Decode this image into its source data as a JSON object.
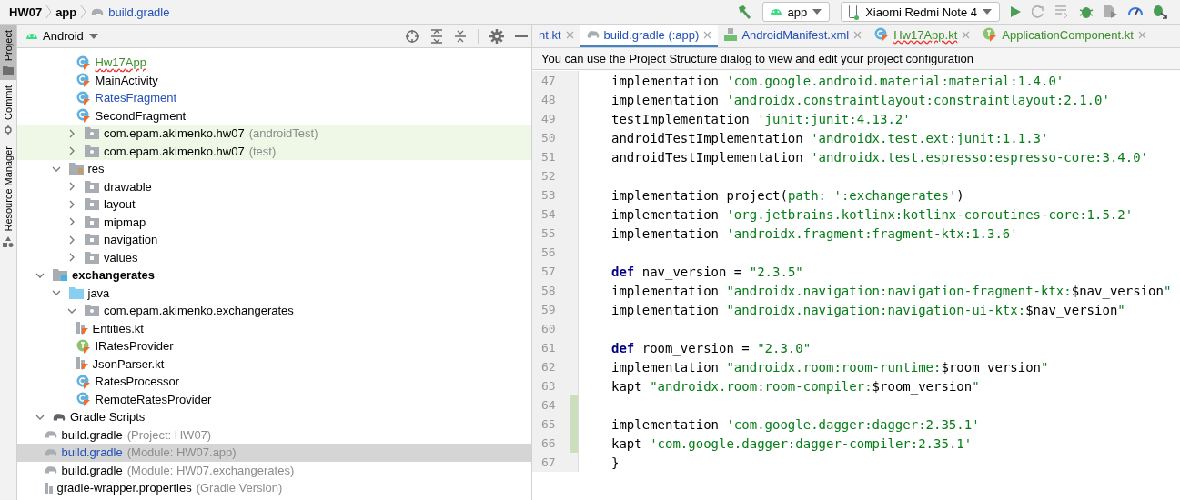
{
  "breadcrumb": [
    {
      "label": "HW07",
      "kind": "project"
    },
    {
      "label": "app",
      "kind": "module"
    },
    {
      "label": "build.gradle",
      "kind": "gradle"
    }
  ],
  "run_config": {
    "label": "app"
  },
  "device": {
    "label": "Xiaomi Redmi Note 4"
  },
  "tool_tabs": [
    {
      "label": "Project",
      "selected": true
    },
    {
      "label": "Commit",
      "selected": false
    },
    {
      "label": "Resource Manager",
      "selected": false
    }
  ],
  "project_view": {
    "mode": "Android"
  },
  "tree": [
    {
      "children": [
        {
          "children": [
            {
              "children": [
                {
                  "label": "Hw17App",
                  "kind": "class",
                  "added": true,
                  "modified": false,
                  "error": true,
                  "selected": false
                },
                {
                  "label": "MainActivity",
                  "kind": "class",
                  "added": false,
                  "modified": false,
                  "error": false,
                  "selected": false
                },
                {
                  "label": "RatesFragment",
                  "kind": "class",
                  "added": false,
                  "modified": true,
                  "error": false,
                  "selected": false
                },
                {
                  "label": "SecondFragment",
                  "kind": "class",
                  "added": false,
                  "modified": false,
                  "error": false,
                  "selected": false
                }
              ]
            },
            {
              "label": "com.epam.akimenko.hw07",
              "note": "(androidTest)",
              "kind": "package",
              "added": false,
              "modified": false,
              "error": false,
              "selected": false,
              "expanded": false,
              "test": true
            },
            {
              "label": "com.epam.akimenko.hw07",
              "note": "(test)",
              "kind": "package",
              "added": false,
              "modified": false,
              "error": false,
              "selected": false,
              "expanded": false,
              "test": true
            }
          ]
        },
        {
          "label": "res",
          "kind": "res-folder",
          "added": false,
          "modified": false,
          "error": false,
          "selected": false,
          "expanded": true,
          "children": [
            {
              "label": "drawable",
              "kind": "folder",
              "added": false,
              "modified": false,
              "error": false,
              "selected": false,
              "expanded": false
            },
            {
              "label": "layout",
              "kind": "folder",
              "added": false,
              "modified": false,
              "error": false,
              "selected": false,
              "expanded": false
            },
            {
              "label": "mipmap",
              "kind": "folder",
              "added": false,
              "modified": false,
              "error": false,
              "selected": false,
              "expanded": false
            },
            {
              "label": "navigation",
              "kind": "folder",
              "added": false,
              "modified": false,
              "error": false,
              "selected": false,
              "expanded": false
            },
            {
              "label": "values",
              "kind": "folder",
              "added": false,
              "modified": false,
              "error": false,
              "selected": false,
              "expanded": false
            }
          ]
        }
      ]
    },
    {
      "label": "exchangerates",
      "kind": "module",
      "added": false,
      "modified": false,
      "error": false,
      "selected": false,
      "expanded": true,
      "children": [
        {
          "label": "java",
          "kind": "java-folder",
          "added": false,
          "modified": false,
          "error": false,
          "selected": false,
          "expanded": true,
          "children": [
            {
              "label": "com.epam.akimenko.exchangerates",
              "kind": "package",
              "added": false,
              "modified": false,
              "error": false,
              "selected": false,
              "expanded": true,
              "children": [
                {
                  "label": "Entities.kt",
                  "kind": "kotlin-file",
                  "added": false,
                  "modified": false,
                  "error": false,
                  "selected": false
                },
                {
                  "label": "IRatesProvider",
                  "kind": "interface",
                  "added": false,
                  "modified": false,
                  "error": false,
                  "selected": false
                },
                {
                  "label": "JsonParser.kt",
                  "kind": "kotlin-file",
                  "added": false,
                  "modified": false,
                  "error": false,
                  "selected": false
                },
                {
                  "label": "RatesProcessor",
                  "kind": "class",
                  "added": false,
                  "modified": false,
                  "error": false,
                  "selected": false
                },
                {
                  "label": "RemoteRatesProvider",
                  "kind": "class",
                  "added": false,
                  "modified": false,
                  "error": false,
                  "selected": false
                }
              ]
            }
          ]
        }
      ]
    },
    {
      "label": "Gradle Scripts",
      "kind": "gradle-scripts",
      "added": false,
      "modified": false,
      "error": false,
      "selected": false,
      "expanded": true,
      "children": [
        {
          "label": "build.gradle",
          "note": "(Project: HW07)",
          "kind": "gradle",
          "added": false,
          "modified": false,
          "error": false,
          "selected": false
        },
        {
          "label": "build.gradle",
          "note": "(Module: HW07.app)",
          "kind": "gradle",
          "added": false,
          "modified": true,
          "error": false,
          "selected": true
        },
        {
          "label": "build.gradle",
          "note": "(Module: HW07.exchangerates)",
          "kind": "gradle",
          "added": false,
          "modified": false,
          "error": false,
          "selected": false
        },
        {
          "label": "gradle-wrapper.properties",
          "note": "(Gradle Version)",
          "kind": "properties",
          "added": false,
          "modified": false,
          "error": false,
          "selected": false
        }
      ]
    }
  ],
  "editor_tabs": [
    {
      "label": "nt.kt",
      "kind": "partial",
      "added": false,
      "modified": true,
      "error": false,
      "selected": false
    },
    {
      "label": "build.gradle (:app)",
      "kind": "gradle",
      "added": false,
      "modified": true,
      "error": false,
      "selected": true
    },
    {
      "label": "AndroidManifest.xml",
      "kind": "manifest",
      "added": false,
      "modified": true,
      "error": false,
      "selected": false
    },
    {
      "label": "Hw17App.kt",
      "kind": "class",
      "added": true,
      "modified": false,
      "error": true,
      "selected": false
    },
    {
      "label": "ApplicationComponent.kt",
      "kind": "interface",
      "added": true,
      "modified": false,
      "error": false,
      "selected": false
    }
  ],
  "banner": "You can use the Project Structure dialog to view and edit your project configuration",
  "code": {
    "lines": [
      {
        "number": "47",
        "changed": false,
        "tokens": [
          {
            "kind": "plain",
            "t": "implementation "
          },
          {
            "kind": "string",
            "t": "'com.google.android.material:material:1.4.0'"
          }
        ]
      },
      {
        "number": "48",
        "changed": false,
        "tokens": [
          {
            "kind": "plain",
            "t": "implementation "
          },
          {
            "kind": "string",
            "t": "'androidx.constraintlayout:constraintlayout:2.1.0'"
          }
        ]
      },
      {
        "number": "49",
        "changed": false,
        "tokens": [
          {
            "kind": "plain",
            "t": "testImplementation "
          },
          {
            "kind": "string",
            "t": "'junit:junit:4.13.2'"
          }
        ]
      },
      {
        "number": "50",
        "changed": false,
        "tokens": [
          {
            "kind": "plain",
            "t": "androidTestImplementation "
          },
          {
            "kind": "string",
            "t": "'androidx.test.ext:junit:1.1.3'"
          }
        ]
      },
      {
        "number": "51",
        "changed": false,
        "tokens": [
          {
            "kind": "plain",
            "t": "androidTestImplementation "
          },
          {
            "kind": "string",
            "t": "'androidx.test.espresso:espresso-core:3.4.0'"
          }
        ]
      },
      {
        "number": "52",
        "changed": false
      },
      {
        "number": "53",
        "changed": false,
        "tokens": [
          {
            "kind": "plain",
            "t": "implementation project("
          },
          {
            "kind": "string",
            "t": "path: ':exchangerates'"
          },
          {
            "kind": "plain",
            "t": ")"
          }
        ]
      },
      {
        "number": "54",
        "changed": false,
        "tokens": [
          {
            "kind": "plain",
            "t": "implementation "
          },
          {
            "kind": "string",
            "t": "'org.jetbrains.kotlinx:kotlinx-coroutines-core:1.5.2'"
          }
        ]
      },
      {
        "number": "55",
        "changed": false,
        "tokens": [
          {
            "kind": "plain",
            "t": "implementation "
          },
          {
            "kind": "string",
            "t": "'androidx.fragment:fragment-ktx:1.3.6'"
          }
        ]
      },
      {
        "number": "56",
        "changed": false
      },
      {
        "number": "57",
        "changed": false,
        "tokens": [
          {
            "kind": "keyword",
            "t": "def"
          },
          {
            "kind": "plain",
            "t": " nav_version = "
          },
          {
            "kind": "string",
            "t": "\"2.3.5\""
          }
        ]
      },
      {
        "number": "58",
        "changed": false,
        "tokens": [
          {
            "kind": "plain",
            "t": "implementation "
          },
          {
            "kind": "string",
            "t": "\"androidx.navigation:navigation-fragment-ktx:"
          },
          {
            "kind": "plain",
            "t": "$nav_version"
          },
          {
            "kind": "string",
            "t": "\""
          }
        ]
      },
      {
        "number": "59",
        "changed": false,
        "tokens": [
          {
            "kind": "plain",
            "t": "implementation "
          },
          {
            "kind": "string",
            "t": "\"androidx.navigation:navigation-ui-ktx:"
          },
          {
            "kind": "plain",
            "t": "$nav_version"
          },
          {
            "kind": "string",
            "t": "\""
          }
        ]
      },
      {
        "number": "60",
        "changed": false
      },
      {
        "number": "61",
        "changed": false,
        "tokens": [
          {
            "kind": "keyword",
            "t": "def"
          },
          {
            "kind": "plain",
            "t": " room_version = "
          },
          {
            "kind": "string",
            "t": "\"2.3.0\""
          }
        ]
      },
      {
        "number": "62",
        "changed": false,
        "tokens": [
          {
            "kind": "plain",
            "t": "implementation "
          },
          {
            "kind": "string",
            "t": "\"androidx.room:room-runtime:"
          },
          {
            "kind": "plain",
            "t": "$room_version"
          },
          {
            "kind": "string",
            "t": "\""
          }
        ]
      },
      {
        "number": "63",
        "changed": false,
        "tokens": [
          {
            "kind": "plain",
            "t": "kapt "
          },
          {
            "kind": "string",
            "t": "\"androidx.room:room-compiler:"
          },
          {
            "kind": "plain",
            "t": "$room_version"
          },
          {
            "kind": "string",
            "t": "\""
          }
        ]
      },
      {
        "number": "64",
        "changed": true
      },
      {
        "number": "65",
        "changed": true,
        "tokens": [
          {
            "kind": "plain",
            "t": "implementation "
          },
          {
            "kind": "string",
            "t": "'com.google.dagger:dagger:2.35.1'"
          }
        ]
      },
      {
        "number": "66",
        "changed": true,
        "tokens": [
          {
            "kind": "plain",
            "t": "kapt "
          },
          {
            "kind": "string",
            "t": "'com.google.dagger:dagger-compiler:2.35.1'"
          }
        ]
      }
    ],
    "closing": {
      "number": "67",
      "text": "}"
    }
  }
}
